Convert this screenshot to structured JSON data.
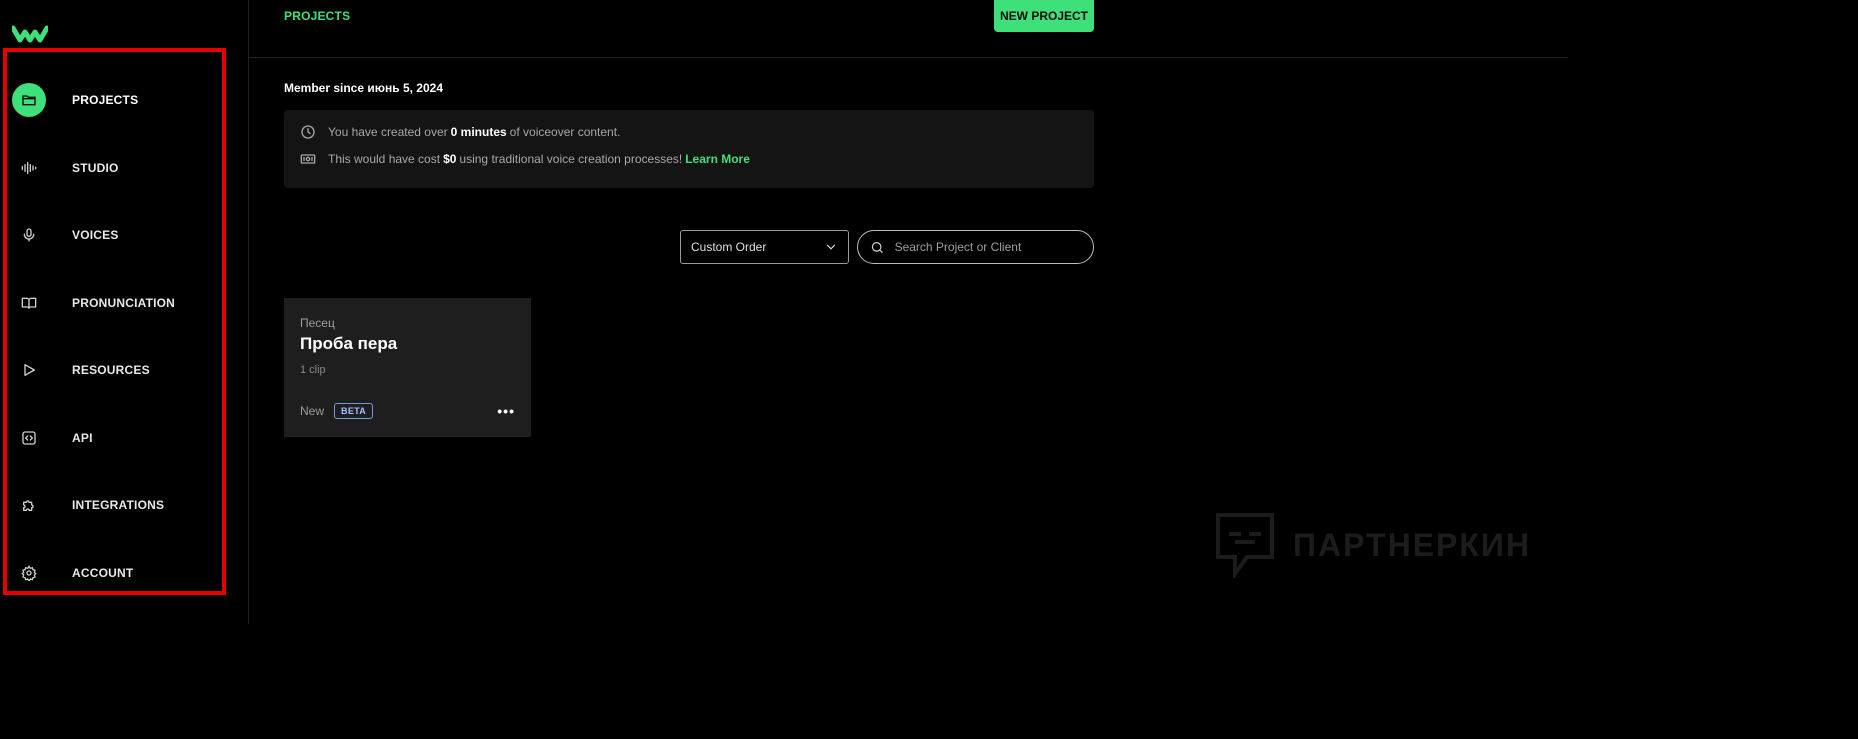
{
  "sidebar": {
    "items": [
      {
        "label": "PROJECTS",
        "icon": "folder-icon",
        "active": true
      },
      {
        "label": "STUDIO",
        "icon": "waveform-icon"
      },
      {
        "label": "VOICES",
        "icon": "microphone-icon"
      },
      {
        "label": "PRONUNCIATION",
        "icon": "book-icon"
      },
      {
        "label": "RESOURCES",
        "icon": "play-icon"
      },
      {
        "label": "API",
        "icon": "code-icon"
      },
      {
        "label": "INTEGRATIONS",
        "icon": "puzzle-icon"
      },
      {
        "label": "ACCOUNT",
        "icon": "gear-icon"
      }
    ]
  },
  "header": {
    "breadcrumb": "PROJECTS",
    "new_project_label": "NEW PROJECT"
  },
  "member_since": "Member since июнь 5, 2024",
  "stats": {
    "line1_prefix": "You have created over",
    "line1_value": "0 minutes",
    "line1_suffix": "of voiceover content.",
    "line2_prefix": "This would have cost",
    "line2_value": "$0",
    "line2_suffix": "using traditional voice creation processes!",
    "learn_more": "Learn More"
  },
  "filters": {
    "sort_selected": "Custom Order",
    "search_placeholder": "Search Project or Client"
  },
  "projects": [
    {
      "client": "Песец",
      "title": "Проба пера",
      "clips": "1 clip",
      "status": "New",
      "badge": "BETA"
    }
  ],
  "watermark": "ПАРТНЕРКИН",
  "colors": {
    "accent": "#3ee07a",
    "highlight": "#e60000",
    "background": "#000000"
  }
}
